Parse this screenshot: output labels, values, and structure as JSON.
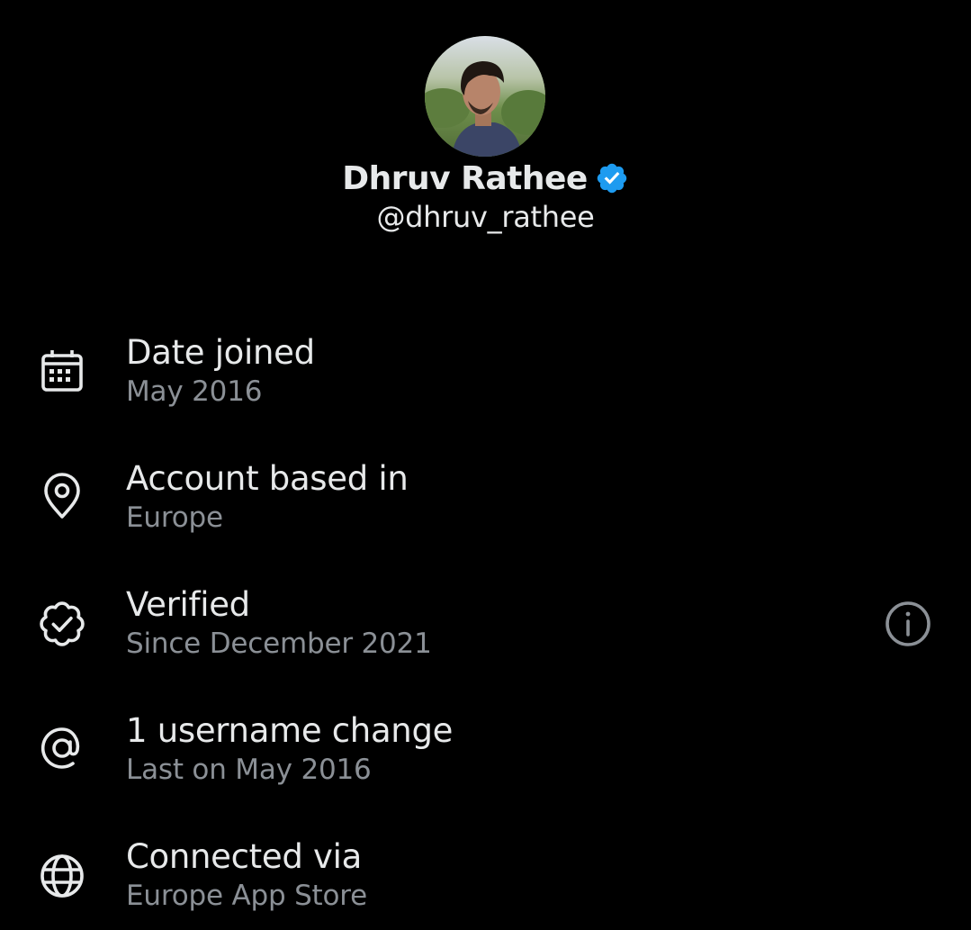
{
  "profile": {
    "display_name": "Dhruv Rathee",
    "handle": "@dhruv_rathee",
    "verified_badge_color": "#1d9bf0"
  },
  "info_rows": [
    {
      "icon": "calendar-icon",
      "title": "Date joined",
      "subtitle": "May 2016"
    },
    {
      "icon": "location-pin-icon",
      "title": "Account based in",
      "subtitle": "Europe"
    },
    {
      "icon": "verified-check-icon",
      "title": "Verified",
      "subtitle": "Since December 2021",
      "has_info_button": true
    },
    {
      "icon": "at-sign-icon",
      "title": "1 username change",
      "subtitle": "Last on May 2016"
    },
    {
      "icon": "globe-icon",
      "title": "Connected via",
      "subtitle": "Europe App Store"
    }
  ],
  "colors": {
    "background": "#000000",
    "primary_text": "#e7e9ea",
    "secondary_text": "#8b9096",
    "icon": "#e7e9ea",
    "accent": "#1d9bf0"
  }
}
